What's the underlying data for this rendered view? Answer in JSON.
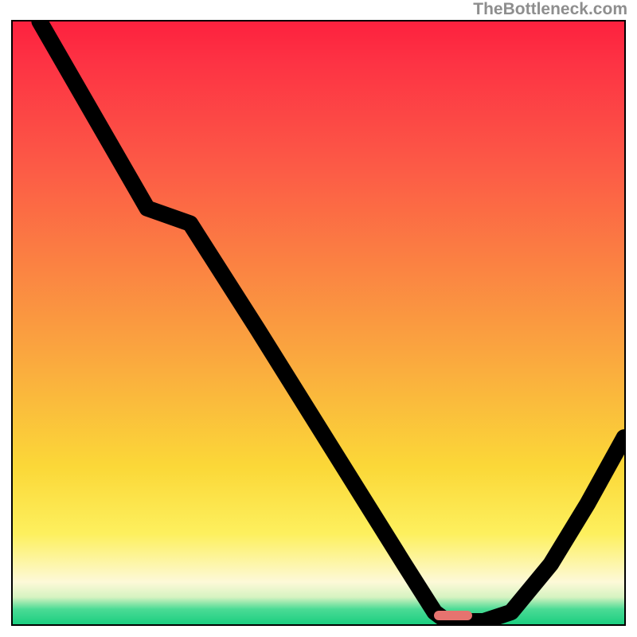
{
  "watermark": "TheBottleneck.com",
  "optimal_marker": {
    "left_pct": 72.0,
    "top_pct": 98.6
  },
  "chart_data": {
    "type": "line",
    "title": "",
    "xlabel": "",
    "ylabel": "",
    "xlim": [
      0,
      100
    ],
    "ylim": [
      0,
      100
    ],
    "y_direction": "down_is_better",
    "colormap": "red-yellow-green (vertical, top=red=bad, bottom=green=good)",
    "x": [
      4.4,
      22,
      29,
      40,
      52,
      64,
      69,
      71,
      77,
      81.5,
      88,
      94,
      100
    ],
    "values": [
      100,
      69,
      66.5,
      49,
      29.5,
      10,
      2,
      0.5,
      0.5,
      2,
      10,
      20,
      31
    ],
    "optimal_x_range": [
      71,
      77
    ],
    "series_stroke": "#000000"
  }
}
